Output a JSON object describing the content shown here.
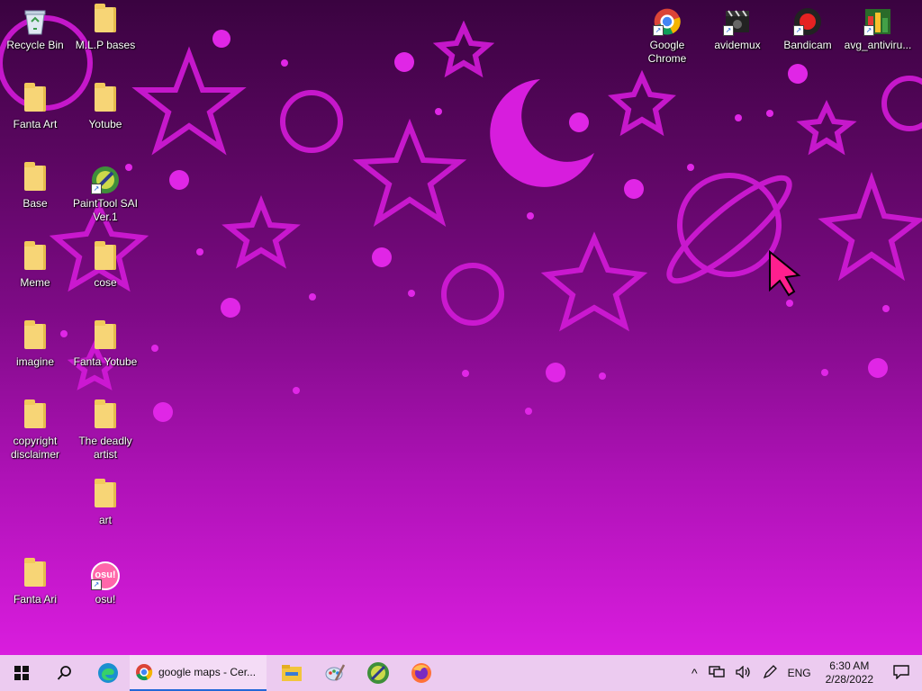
{
  "desktop": {
    "icons": [
      {
        "id": "recycle-bin",
        "label": "Recycle Bin",
        "type": "recycle",
        "col": 0,
        "row": 0
      },
      {
        "id": "mlp-bases",
        "label": "M.L.P bases",
        "type": "folder",
        "col": 1,
        "row": 0
      },
      {
        "id": "fanta-art",
        "label": "Fanta Art",
        "type": "folder",
        "col": 0,
        "row": 1
      },
      {
        "id": "yotube",
        "label": "Yotube",
        "type": "folder",
        "col": 1,
        "row": 1
      },
      {
        "id": "base",
        "label": "Base",
        "type": "folder",
        "col": 0,
        "row": 2
      },
      {
        "id": "painttool-sai",
        "label": "PaintTool SAI Ver.1",
        "type": "app-sai",
        "col": 1,
        "row": 2
      },
      {
        "id": "meme",
        "label": "Meme",
        "type": "folder",
        "col": 0,
        "row": 3
      },
      {
        "id": "cose",
        "label": "cose",
        "type": "folder",
        "col": 1,
        "row": 3
      },
      {
        "id": "imagine",
        "label": "imagine",
        "type": "folder",
        "col": 0,
        "row": 4
      },
      {
        "id": "fanta-yotube",
        "label": "Fanta Yotube",
        "type": "folder",
        "col": 1,
        "row": 4
      },
      {
        "id": "copyright-disclaimer",
        "label": "copyright disclaimer",
        "type": "folder",
        "col": 0,
        "row": 5
      },
      {
        "id": "the-deadly-artist",
        "label": "The deadly artist",
        "type": "folder",
        "col": 1,
        "row": 5
      },
      {
        "id": "art",
        "label": "art",
        "type": "folder",
        "col": 1,
        "row": 6
      },
      {
        "id": "fanta-ari",
        "label": "Fanta Ari",
        "type": "folder",
        "col": 0,
        "row": 7
      },
      {
        "id": "osu",
        "label": "osu!",
        "type": "app-osu",
        "col": 1,
        "row": 7
      },
      {
        "id": "google-chrome",
        "label": "Google Chrome",
        "type": "app-chrome",
        "col": "r0",
        "row": 0
      },
      {
        "id": "avidemux",
        "label": "avidemux",
        "type": "app-avidemux",
        "col": "r1",
        "row": 0
      },
      {
        "id": "bandicam",
        "label": "Bandicam",
        "type": "app-bandicam",
        "col": "r2",
        "row": 0
      },
      {
        "id": "avg-antivirus",
        "label": "avg_antiviru...",
        "type": "app-avg",
        "col": "r3",
        "row": 0
      }
    ],
    "osu_badge": "osu!"
  },
  "taskbar": {
    "start_icon": "windows-icon",
    "search_icon": "search-icon",
    "edge_icon": "edge-icon",
    "active_app_label": "google maps - Cer...",
    "pinned": [
      "file-explorer-icon",
      "paint-icon",
      "paintool-sai-icon",
      "firefox-icon"
    ],
    "tray": {
      "chevron": "^",
      "language": "ENG",
      "time": "6:30 AM",
      "date": "2/28/2022"
    }
  },
  "colors": {
    "accent": "#2468d8",
    "taskbar_bg": "#eccbf0",
    "wallpaper_pink": "#e01ee6"
  }
}
